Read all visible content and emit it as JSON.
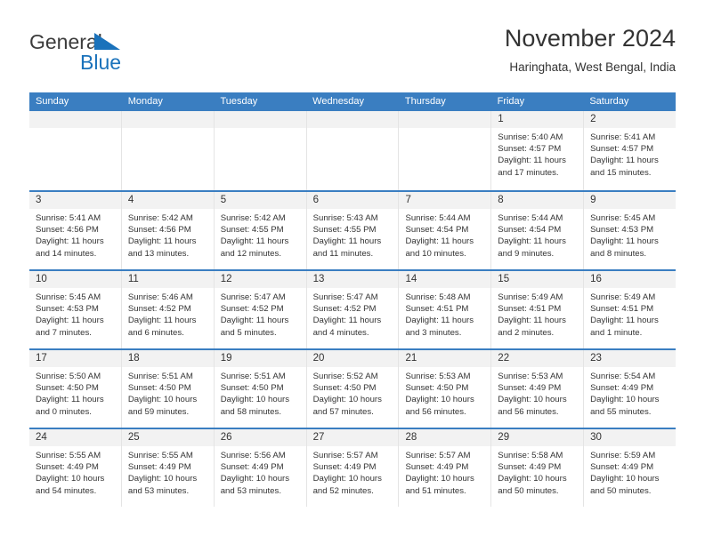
{
  "brand": {
    "name_part1": "General",
    "name_part2": "Blue",
    "triangle_icon": "triangle-icon",
    "accent_color": "#1a72bb"
  },
  "header": {
    "title": "November 2024",
    "subtitle": "Haringhata, West Bengal, India"
  },
  "calendar": {
    "header_bg": "#3a7ec1",
    "day_band_bg": "#f2f2f2",
    "weekdays": [
      "Sunday",
      "Monday",
      "Tuesday",
      "Wednesday",
      "Thursday",
      "Friday",
      "Saturday"
    ],
    "labels": {
      "sunrise": "Sunrise:",
      "sunset": "Sunset:",
      "daylight": "Daylight:"
    },
    "weeks": [
      [
        {
          "day": "",
          "empty": true
        },
        {
          "day": "",
          "empty": true
        },
        {
          "day": "",
          "empty": true
        },
        {
          "day": "",
          "empty": true
        },
        {
          "day": "",
          "empty": true
        },
        {
          "day": "1",
          "sunrise": "Sunrise: 5:40 AM",
          "sunset": "Sunset: 4:57 PM",
          "daylight": "Daylight: 11 hours and 17 minutes."
        },
        {
          "day": "2",
          "sunrise": "Sunrise: 5:41 AM",
          "sunset": "Sunset: 4:57 PM",
          "daylight": "Daylight: 11 hours and 15 minutes."
        }
      ],
      [
        {
          "day": "3",
          "sunrise": "Sunrise: 5:41 AM",
          "sunset": "Sunset: 4:56 PM",
          "daylight": "Daylight: 11 hours and 14 minutes."
        },
        {
          "day": "4",
          "sunrise": "Sunrise: 5:42 AM",
          "sunset": "Sunset: 4:56 PM",
          "daylight": "Daylight: 11 hours and 13 minutes."
        },
        {
          "day": "5",
          "sunrise": "Sunrise: 5:42 AM",
          "sunset": "Sunset: 4:55 PM",
          "daylight": "Daylight: 11 hours and 12 minutes."
        },
        {
          "day": "6",
          "sunrise": "Sunrise: 5:43 AM",
          "sunset": "Sunset: 4:55 PM",
          "daylight": "Daylight: 11 hours and 11 minutes."
        },
        {
          "day": "7",
          "sunrise": "Sunrise: 5:44 AM",
          "sunset": "Sunset: 4:54 PM",
          "daylight": "Daylight: 11 hours and 10 minutes."
        },
        {
          "day": "8",
          "sunrise": "Sunrise: 5:44 AM",
          "sunset": "Sunset: 4:54 PM",
          "daylight": "Daylight: 11 hours and 9 minutes."
        },
        {
          "day": "9",
          "sunrise": "Sunrise: 5:45 AM",
          "sunset": "Sunset: 4:53 PM",
          "daylight": "Daylight: 11 hours and 8 minutes."
        }
      ],
      [
        {
          "day": "10",
          "sunrise": "Sunrise: 5:45 AM",
          "sunset": "Sunset: 4:53 PM",
          "daylight": "Daylight: 11 hours and 7 minutes."
        },
        {
          "day": "11",
          "sunrise": "Sunrise: 5:46 AM",
          "sunset": "Sunset: 4:52 PM",
          "daylight": "Daylight: 11 hours and 6 minutes."
        },
        {
          "day": "12",
          "sunrise": "Sunrise: 5:47 AM",
          "sunset": "Sunset: 4:52 PM",
          "daylight": "Daylight: 11 hours and 5 minutes."
        },
        {
          "day": "13",
          "sunrise": "Sunrise: 5:47 AM",
          "sunset": "Sunset: 4:52 PM",
          "daylight": "Daylight: 11 hours and 4 minutes."
        },
        {
          "day": "14",
          "sunrise": "Sunrise: 5:48 AM",
          "sunset": "Sunset: 4:51 PM",
          "daylight": "Daylight: 11 hours and 3 minutes."
        },
        {
          "day": "15",
          "sunrise": "Sunrise: 5:49 AM",
          "sunset": "Sunset: 4:51 PM",
          "daylight": "Daylight: 11 hours and 2 minutes."
        },
        {
          "day": "16",
          "sunrise": "Sunrise: 5:49 AM",
          "sunset": "Sunset: 4:51 PM",
          "daylight": "Daylight: 11 hours and 1 minute."
        }
      ],
      [
        {
          "day": "17",
          "sunrise": "Sunrise: 5:50 AM",
          "sunset": "Sunset: 4:50 PM",
          "daylight": "Daylight: 11 hours and 0 minutes."
        },
        {
          "day": "18",
          "sunrise": "Sunrise: 5:51 AM",
          "sunset": "Sunset: 4:50 PM",
          "daylight": "Daylight: 10 hours and 59 minutes."
        },
        {
          "day": "19",
          "sunrise": "Sunrise: 5:51 AM",
          "sunset": "Sunset: 4:50 PM",
          "daylight": "Daylight: 10 hours and 58 minutes."
        },
        {
          "day": "20",
          "sunrise": "Sunrise: 5:52 AM",
          "sunset": "Sunset: 4:50 PM",
          "daylight": "Daylight: 10 hours and 57 minutes."
        },
        {
          "day": "21",
          "sunrise": "Sunrise: 5:53 AM",
          "sunset": "Sunset: 4:50 PM",
          "daylight": "Daylight: 10 hours and 56 minutes."
        },
        {
          "day": "22",
          "sunrise": "Sunrise: 5:53 AM",
          "sunset": "Sunset: 4:49 PM",
          "daylight": "Daylight: 10 hours and 56 minutes."
        },
        {
          "day": "23",
          "sunrise": "Sunrise: 5:54 AM",
          "sunset": "Sunset: 4:49 PM",
          "daylight": "Daylight: 10 hours and 55 minutes."
        }
      ],
      [
        {
          "day": "24",
          "sunrise": "Sunrise: 5:55 AM",
          "sunset": "Sunset: 4:49 PM",
          "daylight": "Daylight: 10 hours and 54 minutes."
        },
        {
          "day": "25",
          "sunrise": "Sunrise: 5:55 AM",
          "sunset": "Sunset: 4:49 PM",
          "daylight": "Daylight: 10 hours and 53 minutes."
        },
        {
          "day": "26",
          "sunrise": "Sunrise: 5:56 AM",
          "sunset": "Sunset: 4:49 PM",
          "daylight": "Daylight: 10 hours and 53 minutes."
        },
        {
          "day": "27",
          "sunrise": "Sunrise: 5:57 AM",
          "sunset": "Sunset: 4:49 PM",
          "daylight": "Daylight: 10 hours and 52 minutes."
        },
        {
          "day": "28",
          "sunrise": "Sunrise: 5:57 AM",
          "sunset": "Sunset: 4:49 PM",
          "daylight": "Daylight: 10 hours and 51 minutes."
        },
        {
          "day": "29",
          "sunrise": "Sunrise: 5:58 AM",
          "sunset": "Sunset: 4:49 PM",
          "daylight": "Daylight: 10 hours and 50 minutes."
        },
        {
          "day": "30",
          "sunrise": "Sunrise: 5:59 AM",
          "sunset": "Sunset: 4:49 PM",
          "daylight": "Daylight: 10 hours and 50 minutes."
        }
      ]
    ]
  }
}
